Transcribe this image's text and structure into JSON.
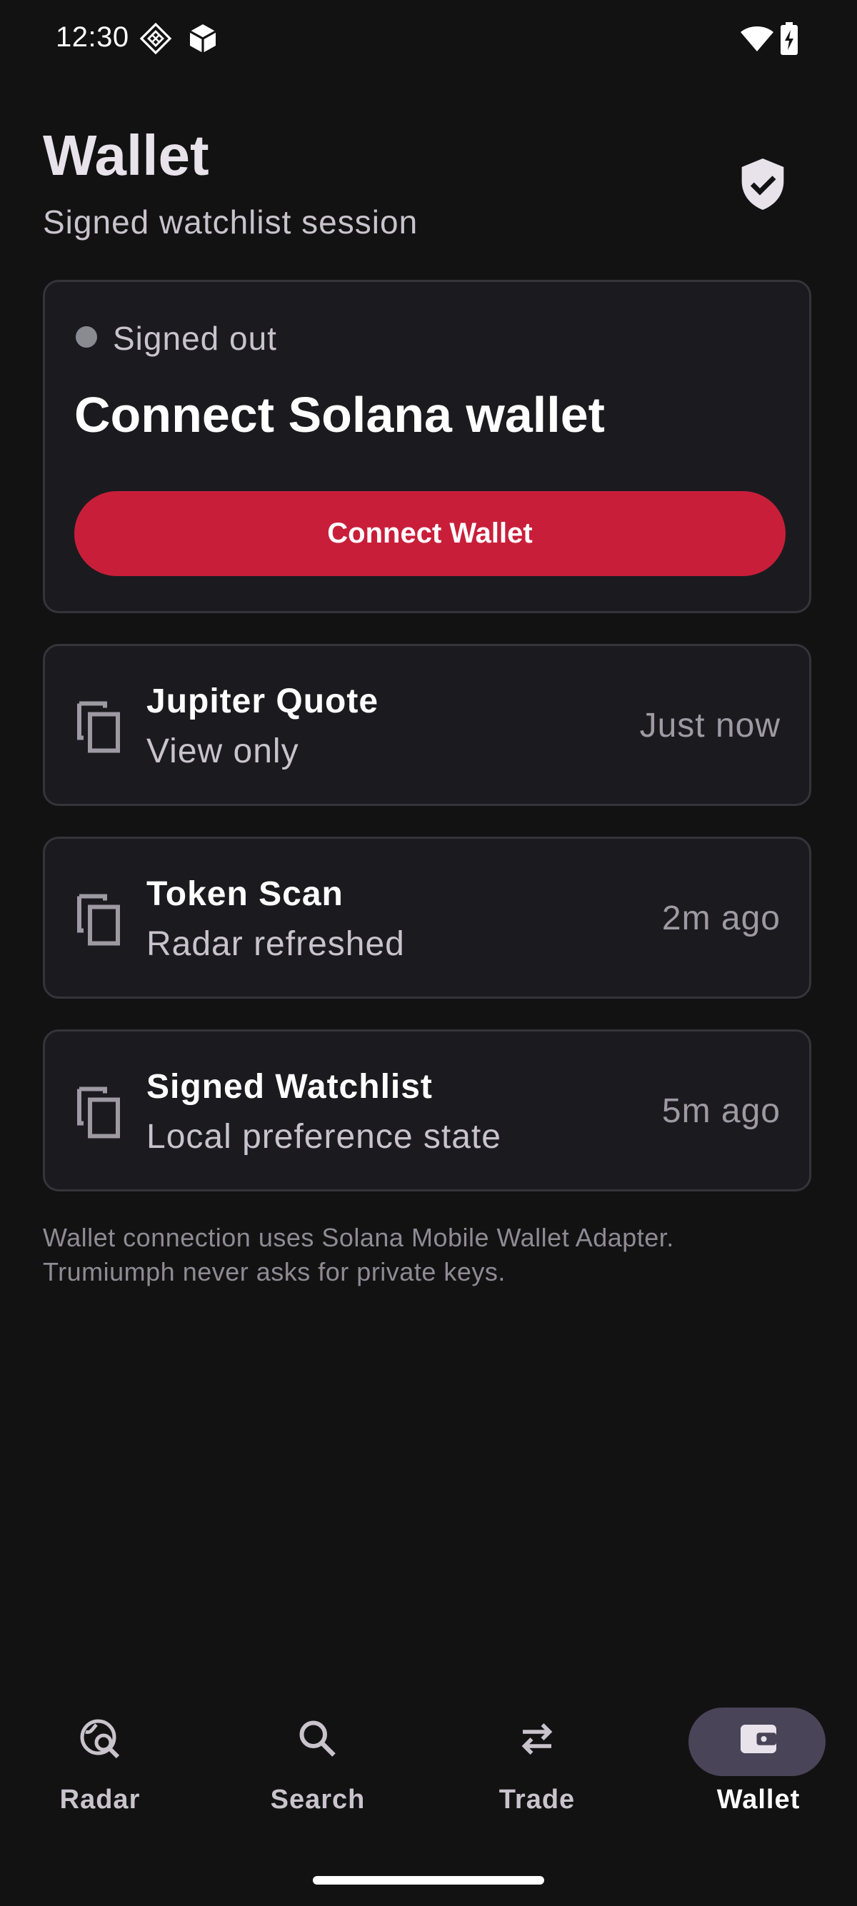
{
  "status_bar": {
    "time": "12:30"
  },
  "header": {
    "title": "Wallet",
    "subtitle": "Signed watchlist session"
  },
  "hero_card": {
    "status": "Signed out",
    "title": "Connect Solana wallet",
    "button_label": "Connect Wallet",
    "accent_color": "#c91e3a"
  },
  "activity": [
    {
      "title": "Jupiter Quote",
      "subtitle": "View only",
      "time": "Just now"
    },
    {
      "title": "Token Scan",
      "subtitle": "Radar refreshed",
      "time": "2m ago"
    },
    {
      "title": "Signed Watchlist",
      "subtitle": "Local preference state",
      "time": "5m ago"
    }
  ],
  "footnote": {
    "line1": "Wallet connection uses Solana Mobile Wallet Adapter.",
    "line2": "Trumiumph never asks for private keys."
  },
  "nav": {
    "items": [
      {
        "label": "Radar",
        "icon": "radar-search-icon"
      },
      {
        "label": "Search",
        "icon": "search-icon"
      },
      {
        "label": "Trade",
        "icon": "swap-arrows-icon"
      },
      {
        "label": "Wallet",
        "icon": "wallet-icon",
        "selected": true
      }
    ]
  }
}
